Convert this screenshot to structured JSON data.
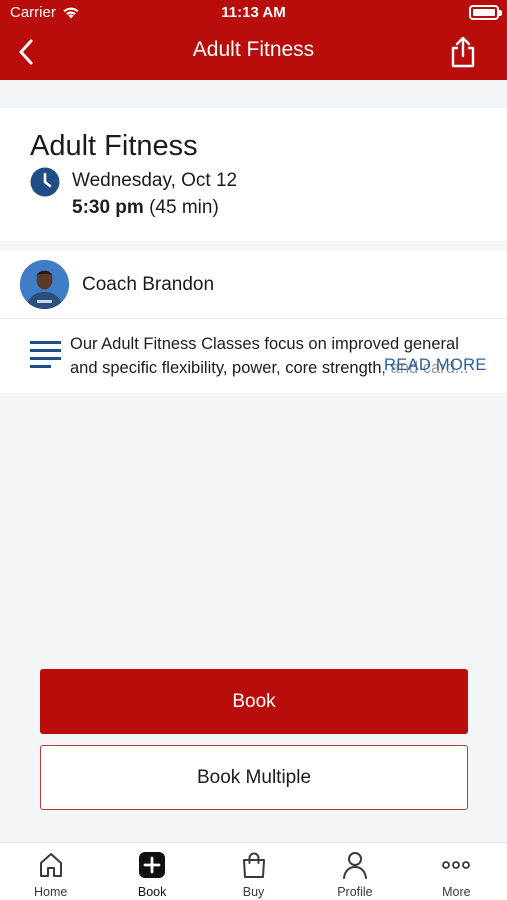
{
  "status_bar": {
    "carrier": "Carrier",
    "time": "11:13 AM"
  },
  "nav": {
    "title": "Adult Fitness"
  },
  "class_info": {
    "title": "Adult Fitness",
    "date": "Wednesday, Oct 12",
    "time": "5:30 pm",
    "duration": "(45 min)"
  },
  "coach": {
    "name": "Coach Brandon"
  },
  "description": {
    "text": "Our Adult Fitness Classes focus on improved general and specific flexibility, power, core strength, and card...",
    "read_more": "READ MORE"
  },
  "actions": {
    "book": "Book",
    "book_multiple": "Book Multiple"
  },
  "tabbar": {
    "items": [
      {
        "label": "Home",
        "icon": "home-icon"
      },
      {
        "label": "Book",
        "icon": "book-plus-icon"
      },
      {
        "label": "Buy",
        "icon": "shopping-bag-icon"
      },
      {
        "label": "Profile",
        "icon": "person-icon"
      },
      {
        "label": "More",
        "icon": "more-dots-icon"
      }
    ],
    "active_index": 1
  },
  "colors": {
    "brand": "#b80d0a",
    "accent": "#2a5f9e",
    "background": "#f4f5f7"
  }
}
